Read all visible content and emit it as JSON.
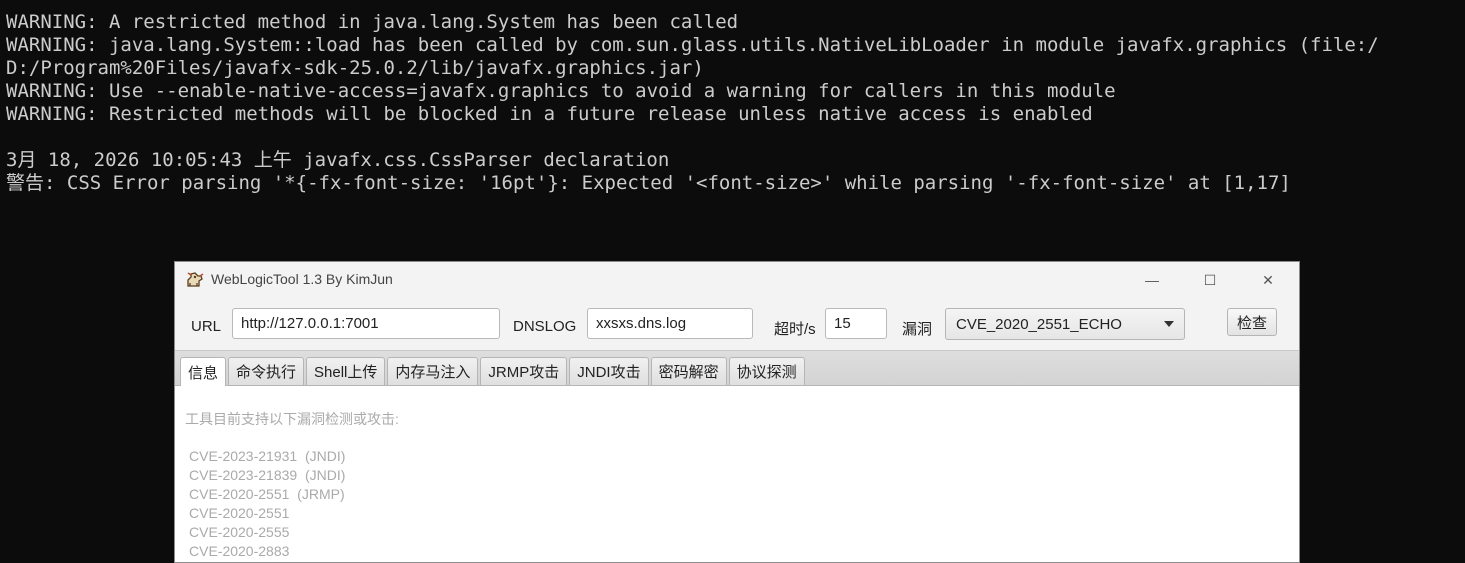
{
  "terminal": {
    "lines": [
      "WARNING: A restricted method in java.lang.System has been called",
      "WARNING: java.lang.System::load has been called by com.sun.glass.utils.NativeLibLoader in module javafx.graphics (file:/",
      "D:/Program%20Files/javafx-sdk-25.0.2/lib/javafx.graphics.jar)",
      "WARNING: Use --enable-native-access=javafx.graphics to avoid a warning for callers in this module",
      "WARNING: Restricted methods will be blocked in a future release unless native access is enabled",
      "",
      "3月 18, 2026 10:05:43 上午 javafx.css.CssParser declaration",
      "警告: CSS Error parsing '*{-fx-font-size: '16pt'}: Expected '<font-size>' while parsing '-fx-font-size' at [1,17]"
    ]
  },
  "window": {
    "title": "WebLogicTool 1.3 By KimJun",
    "controls": {
      "minimize": "—",
      "maximize": "☐",
      "close": "✕"
    }
  },
  "toolbar": {
    "url_label": "URL",
    "url_value": "http://127.0.0.1:7001",
    "dnslog_label": "DNSLOG",
    "dnslog_value": "xxsxs.dns.log",
    "timeout_label": "超时/s",
    "timeout_value": "15",
    "vuln_label": "漏洞",
    "vuln_selected": "CVE_2020_2551_ECHO",
    "check_label": "检查"
  },
  "tabs": [
    {
      "label": "信息",
      "active": true
    },
    {
      "label": "命令执行"
    },
    {
      "label": "Shell上传"
    },
    {
      "label": "内存马注入"
    },
    {
      "label": "JRMP攻击"
    },
    {
      "label": "JNDI攻击"
    },
    {
      "label": "密码解密"
    },
    {
      "label": "协议探测"
    }
  ],
  "content": {
    "intro": "工具目前支持以下漏洞检测或攻击:",
    "items": [
      "CVE-2023-21931  (JNDI)",
      "CVE-2023-21839  (JNDI)",
      "CVE-2020-2551  (JRMP)",
      "CVE-2020-2551",
      "CVE-2020-2555",
      "CVE-2020-2883"
    ]
  }
}
